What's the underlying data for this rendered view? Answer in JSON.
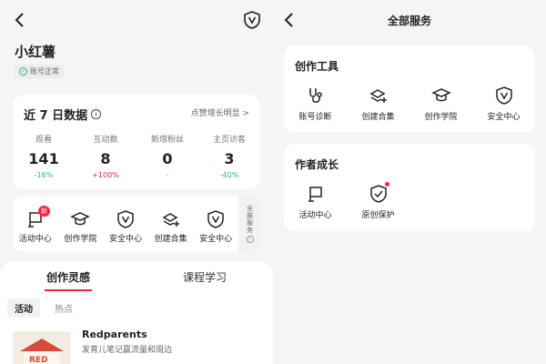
{
  "left": {
    "username": "小红薯",
    "account_status": "账号正常",
    "stats_card": {
      "title": "近 7 日数据",
      "link": "点赞增长明显 >",
      "stats": [
        {
          "label": "观看",
          "value": "141",
          "change": "-16%"
        },
        {
          "label": "互动数",
          "value": "8",
          "change": "+100%"
        },
        {
          "label": "新增粉丝",
          "value": "0",
          "change": "-"
        },
        {
          "label": "主页访客",
          "value": "3",
          "change": "-40%"
        }
      ]
    },
    "tools": [
      {
        "label": "活动中心",
        "icon": "flag-icon",
        "badge": "新"
      },
      {
        "label": "创作学院",
        "icon": "graduation-cap-icon"
      },
      {
        "label": "安全中心",
        "icon": "shield-icon"
      },
      {
        "label": "创建合集",
        "icon": "collection-add-icon"
      },
      {
        "label": "安全中心",
        "icon": "shield-icon"
      }
    ],
    "all_services_label": "全部服务",
    "tabs": [
      "创作灵感",
      "课程学习"
    ],
    "chips": [
      "活动",
      "热点"
    ],
    "activity": {
      "title": "Redparents",
      "desc": "发育儿笔记赢流量和周边"
    },
    "colors": {
      "accent": "#ff2442",
      "up": "#e02e3d",
      "down": "#2bb673"
    }
  },
  "right": {
    "title": "全部服务",
    "sections": [
      {
        "heading": "创作工具",
        "items": [
          {
            "label": "账号诊断",
            "icon": "stethoscope-icon"
          },
          {
            "label": "创建合集",
            "icon": "collection-add-icon"
          },
          {
            "label": "创作学院",
            "icon": "graduation-cap-icon"
          },
          {
            "label": "安全中心",
            "icon": "shield-icon"
          }
        ]
      },
      {
        "heading": "作者成长",
        "items": [
          {
            "label": "活动中心",
            "icon": "flag-icon"
          },
          {
            "label": "原创保护",
            "icon": "shield-check-icon",
            "dot": true
          }
        ]
      }
    ]
  }
}
